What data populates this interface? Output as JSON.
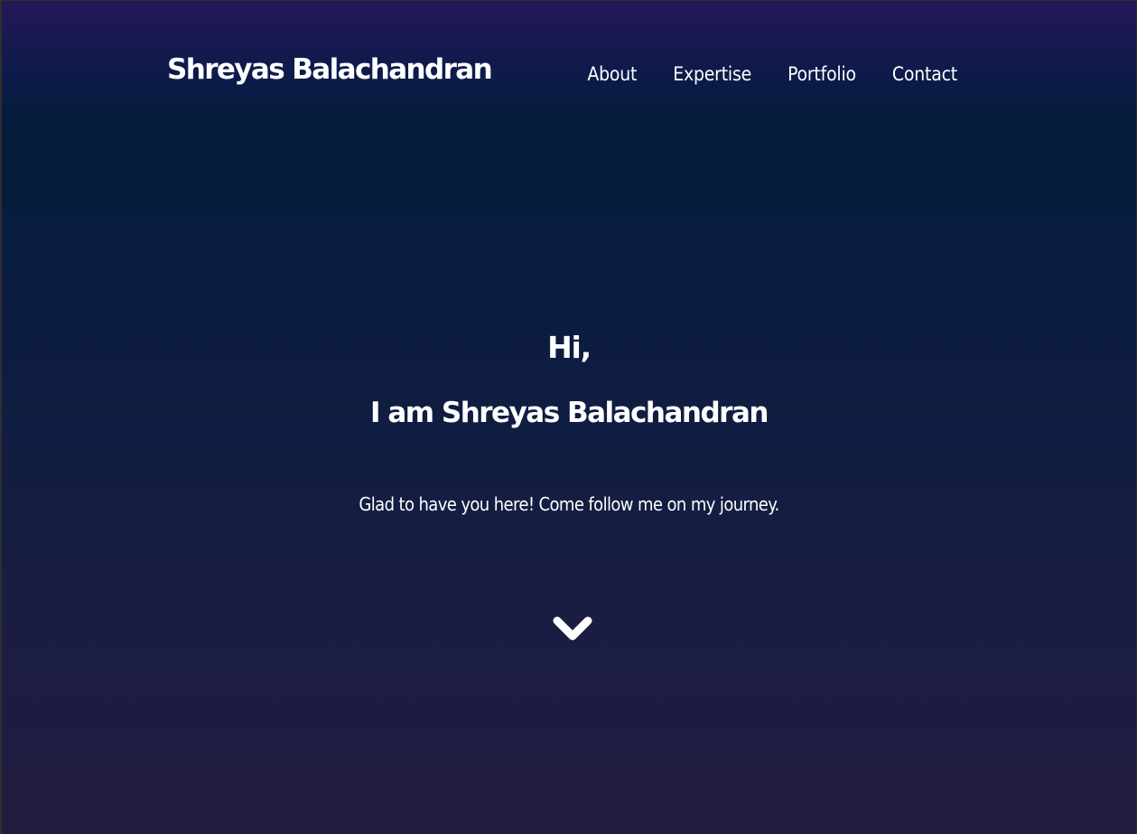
{
  "header": {
    "brand": "Shreyas Balachandran",
    "nav": [
      "About",
      "Expertise",
      "Portfolio",
      "Contact"
    ]
  },
  "hero": {
    "greeting": "Hi,",
    "headline": "I am Shreyas Balachandran",
    "tagline": "Glad to have you here! Come follow me on my journey.",
    "scroll_icon": "chevron-down-icon"
  },
  "colors": {
    "text": "#ffffff",
    "gradient_top": "#251757",
    "gradient_mid": "#041b3a",
    "gradient_bottom": "#211c40"
  }
}
